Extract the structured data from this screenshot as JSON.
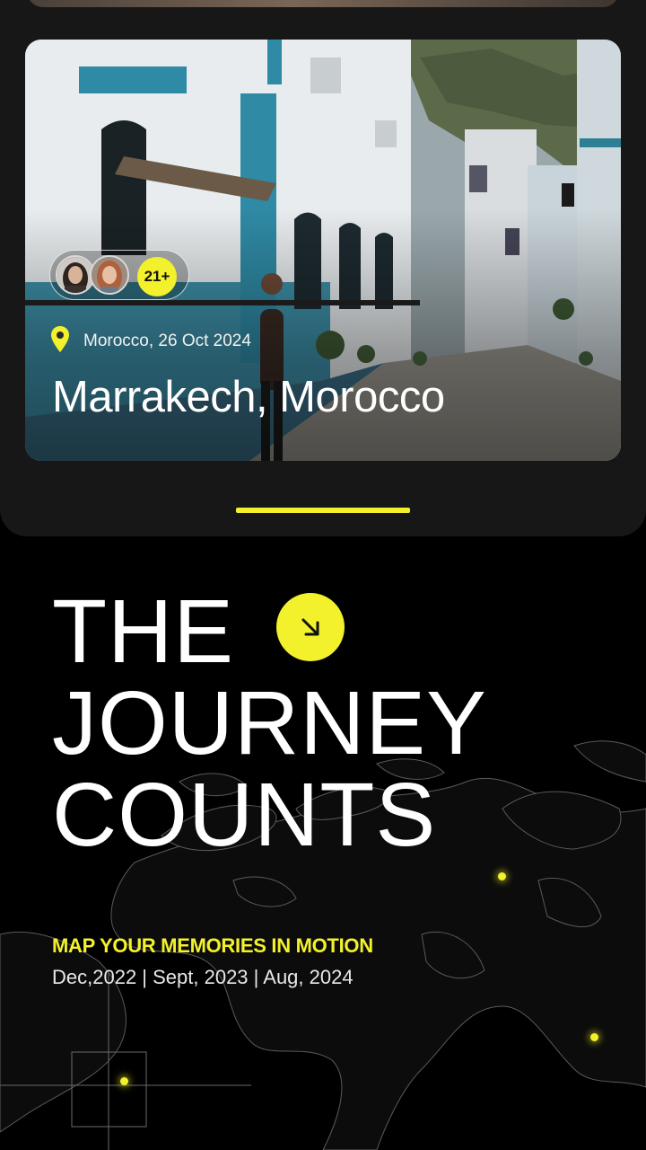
{
  "trip_card": {
    "attendee_count": "21+",
    "meta": "Morocco, 26 Oct 2024",
    "title": "Marrakech, Morocco"
  },
  "hero": {
    "headline_line1": "THE",
    "headline_line2": "JOURNEY",
    "headline_line3": "COUNTS",
    "subheading": "MAP YOUR MEMORIES IN MOTION",
    "dates": "Dec,2022 | Sept, 2023 | Aug, 2024"
  },
  "colors": {
    "accent": "#f2f12b",
    "background": "#000000",
    "panel": "#171717"
  },
  "icons": [
    "map-pin-icon",
    "arrow-down-right-icon"
  ]
}
